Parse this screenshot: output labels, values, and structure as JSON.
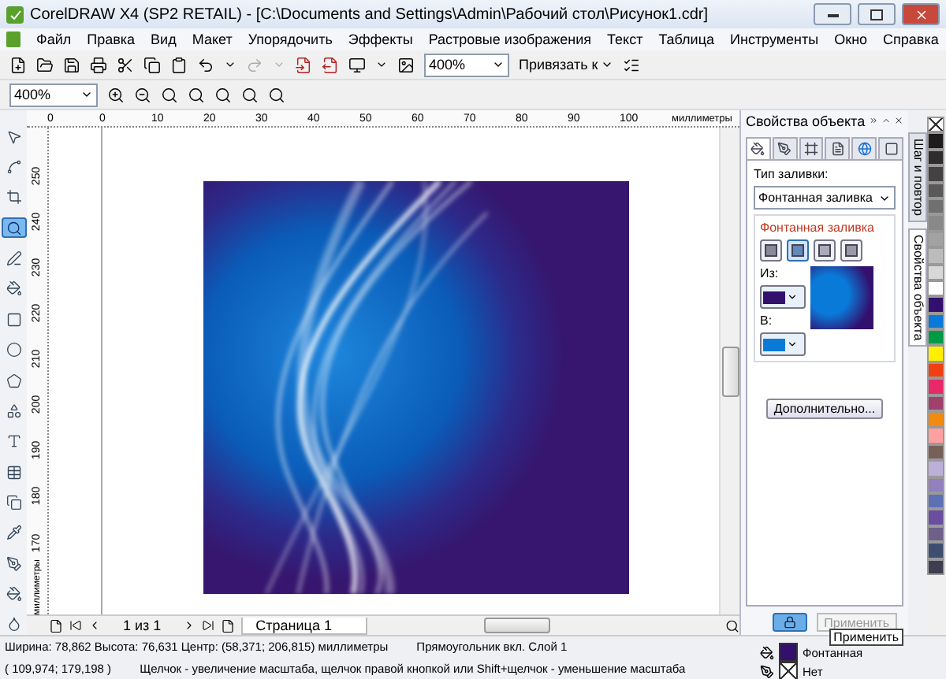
{
  "window": {
    "title": "CorelDRAW X4 (SP2 RETAIL) - [C:\\Documents and Settings\\Admin\\Рабочий стол\\Рисунок1.cdr]"
  },
  "menu": [
    "Файл",
    "Правка",
    "Вид",
    "Макет",
    "Упорядочить",
    "Эффекты",
    "Растровые изображения",
    "Текст",
    "Таблица",
    "Инструменты",
    "Окно",
    "Справка"
  ],
  "toolbar": {
    "zoom": "400%",
    "snap": "Привязать к"
  },
  "zoom_toolbar": {
    "zoom": "400%"
  },
  "toolbox": [
    {
      "kind": "pick",
      "selected": false
    },
    {
      "kind": "shape",
      "selected": false
    },
    {
      "kind": "crop",
      "selected": false
    },
    {
      "kind": "zoom",
      "selected": true
    },
    {
      "kind": "freehand",
      "selected": false
    },
    {
      "kind": "smartfill",
      "selected": false
    },
    {
      "kind": "rectangle",
      "selected": false
    },
    {
      "kind": "ellipse",
      "selected": false
    },
    {
      "kind": "polygon",
      "selected": false
    },
    {
      "kind": "shapes",
      "selected": false
    },
    {
      "kind": "text",
      "selected": false
    },
    {
      "kind": "table",
      "selected": false
    },
    {
      "kind": "shadow",
      "selected": false
    },
    {
      "kind": "eyedropper",
      "selected": false
    },
    {
      "kind": "outline",
      "selected": false
    },
    {
      "kind": "fill",
      "selected": false
    },
    {
      "kind": "interactivefill",
      "selected": false
    }
  ],
  "ruler": {
    "h_labels": [
      "0",
      "0",
      "10",
      "20",
      "30",
      "40",
      "50",
      "60",
      "70",
      "80",
      "90",
      "100"
    ],
    "h_unit": "миллиметры",
    "v_labels": [
      "250",
      "240",
      "230",
      "220",
      "210",
      "200",
      "190",
      "180",
      "170"
    ],
    "v_unit": "миллиметры"
  },
  "page_nav": {
    "counter": "1 из 1",
    "tab": "Страница 1"
  },
  "docker": {
    "title": "Свойства объекта",
    "tabs": [
      {
        "kind": "fill",
        "selected": true
      },
      {
        "kind": "outline",
        "selected": false
      },
      {
        "kind": "frame",
        "selected": false
      },
      {
        "kind": "summary",
        "selected": false
      },
      {
        "kind": "internet",
        "selected": false
      },
      {
        "kind": "general",
        "selected": false
      }
    ],
    "fill_type_label": "Тип заливки:",
    "fill_type": "Фонтанная заливка",
    "group_title": "Фонтанная заливка",
    "gradient_types": [
      {
        "kind": "linear",
        "selected": false
      },
      {
        "kind": "radial",
        "selected": true
      },
      {
        "kind": "conical",
        "selected": false
      },
      {
        "kind": "square",
        "selected": false
      }
    ],
    "gradient_colors": [
      {
        "label": "Из:",
        "color": "#33106e"
      },
      {
        "label": "В:",
        "color": "#0a7ad8"
      }
    ],
    "more_button": "Дополнительно...",
    "apply_button": {
      "label": "Применить",
      "disabled": true
    },
    "tooltip": "Применить"
  },
  "side_tabs": [
    {
      "label": "Шаг и повтор",
      "selected": false
    },
    {
      "label": "Свойства объекта",
      "selected": true
    }
  ],
  "palette": [
    {
      "kind": "none"
    },
    {
      "kind": "swatch",
      "color": "#1e1c1c"
    },
    {
      "kind": "swatch",
      "color": "#2e2c2c"
    },
    {
      "kind": "swatch",
      "color": "#444242"
    },
    {
      "kind": "swatch",
      "color": "#5a5858"
    },
    {
      "kind": "swatch",
      "color": "#717070"
    },
    {
      "kind": "swatch",
      "color": "#8a8989"
    },
    {
      "kind": "swatch",
      "color": "#a3a2a2"
    },
    {
      "kind": "swatch",
      "color": "#bdbcbc"
    },
    {
      "kind": "swatch",
      "color": "#d8d8d8"
    },
    {
      "kind": "swatch",
      "color": "#ffffff"
    },
    {
      "kind": "swatch",
      "color": "#33106e"
    },
    {
      "kind": "swatch",
      "color": "#0a7ad8"
    },
    {
      "kind": "swatch",
      "color": "#009a44"
    },
    {
      "kind": "swatch",
      "color": "#fff000"
    },
    {
      "kind": "swatch",
      "color": "#f04010"
    },
    {
      "kind": "swatch",
      "color": "#e8286a"
    },
    {
      "kind": "swatch",
      "color": "#a0406c"
    },
    {
      "kind": "swatch",
      "color": "#f28a10"
    },
    {
      "kind": "swatch",
      "color": "#ffa0a0"
    },
    {
      "kind": "swatch",
      "color": "#766058"
    },
    {
      "kind": "swatch",
      "color": "#bab0d8"
    },
    {
      "kind": "swatch",
      "color": "#9080c0"
    },
    {
      "kind": "swatch",
      "color": "#5e70b4"
    },
    {
      "kind": "swatch",
      "color": "#6a4ea0"
    },
    {
      "kind": "swatch",
      "color": "#6e6088"
    },
    {
      "kind": "swatch",
      "color": "#3e4e70"
    },
    {
      "kind": "swatch",
      "color": "#3e3e50"
    }
  ],
  "status_bar": {
    "size": "Ширина: 78,862 Высота: 76,631 Центр: (58,371; 206,815) миллиметры",
    "object": "Прямоугольник вкл. Слой 1",
    "coords": "( 109,974; 179,198 )",
    "hint": "Щелчок - увеличение масштаба, щелчок правой кнопкой или Shift+щелчок - уменьшение масштаба",
    "fill": {
      "label": "Фонтанная",
      "color": "#33106e"
    },
    "outline": {
      "label": "Нет"
    }
  }
}
